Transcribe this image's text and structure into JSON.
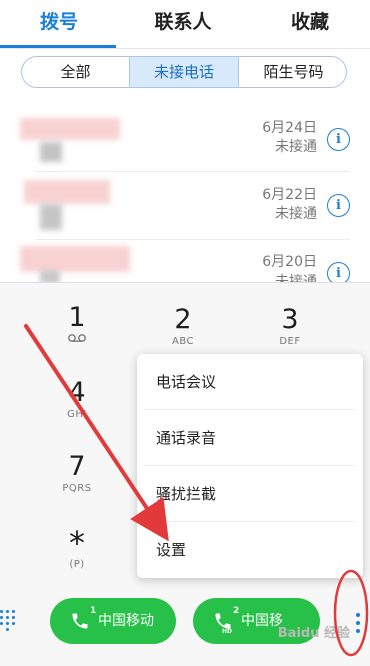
{
  "tabs": [
    {
      "label": "拨号",
      "active": true
    },
    {
      "label": "联系人",
      "active": false
    },
    {
      "label": "收藏",
      "active": false
    }
  ],
  "filter": {
    "options": [
      "全部",
      "未接电话",
      "陌生号码"
    ],
    "selected": "未接电话"
  },
  "call_log": [
    {
      "date": "6月24日",
      "status": "未接通"
    },
    {
      "date": "6月22日",
      "status": "未接通"
    },
    {
      "date": "6月20日",
      "status": "未接通"
    }
  ],
  "dialpad": {
    "keys": [
      {
        "digit": "1",
        "sub": "voicemail-icon"
      },
      {
        "digit": "2",
        "sub": "ABC"
      },
      {
        "digit": "3",
        "sub": "DEF"
      },
      {
        "digit": "4",
        "sub": "GHI"
      },
      {
        "digit": "7",
        "sub": "PQRS"
      },
      {
        "digit": "*",
        "sub": "(P)"
      }
    ]
  },
  "menu": {
    "items": [
      "电话会议",
      "通话录音",
      "骚扰拦截",
      "设置"
    ]
  },
  "bottom": {
    "sim1": {
      "label": "中国移动",
      "badge": "1"
    },
    "sim2": {
      "label": "中国移",
      "badge": "2",
      "hd": "HD"
    }
  },
  "watermark": "Baidu 经验",
  "colors": {
    "accent": "#1a7fd6",
    "call_green": "#27c14a",
    "annotation_red": "#e23a3a"
  }
}
